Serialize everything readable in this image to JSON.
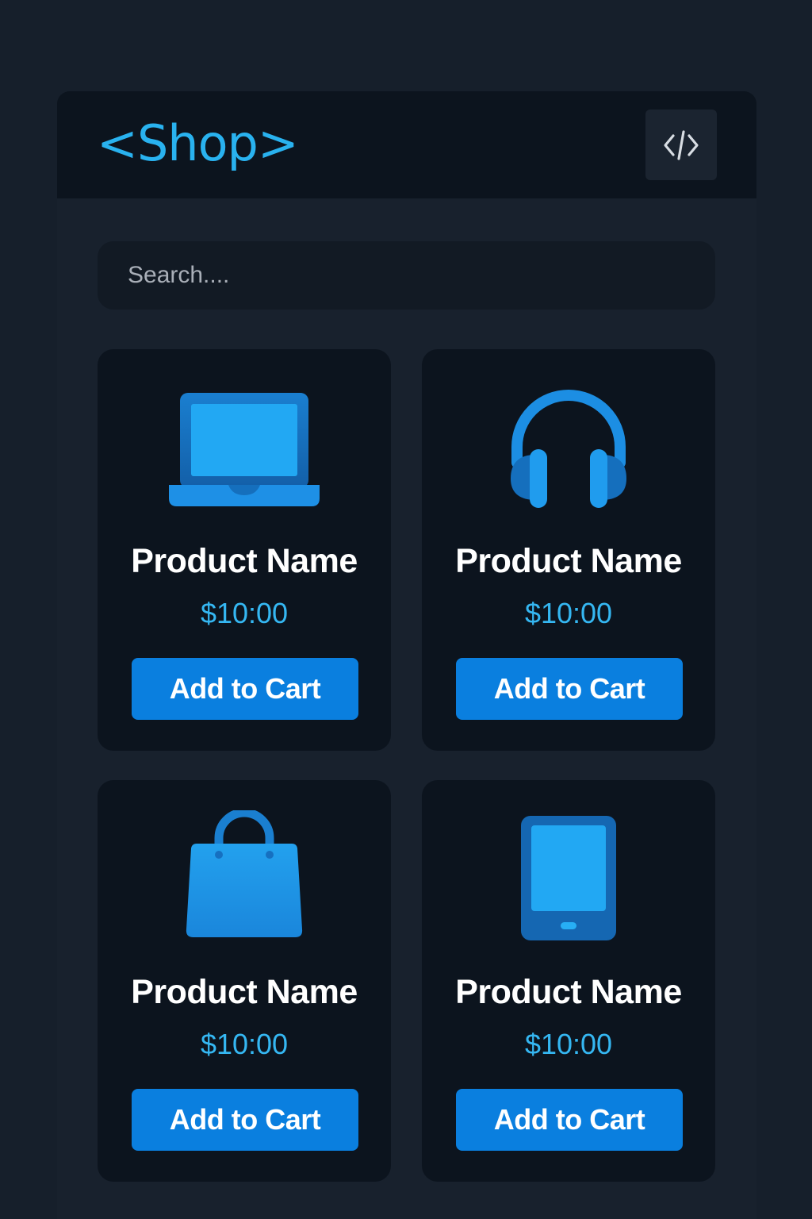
{
  "header": {
    "logo": "<Shop>",
    "code_button_icon": "code-icon"
  },
  "search": {
    "placeholder": "Search...."
  },
  "colors": {
    "accent": "#29b2ef",
    "button": "#0a7fdf",
    "background": "#161f2b",
    "card": "#0c141e"
  },
  "products": [
    {
      "icon": "laptop-icon",
      "name": "Product Name",
      "price": "$10:00",
      "button_label": "Add to Cart"
    },
    {
      "icon": "headphones-icon",
      "name": "Product Name",
      "price": "$10:00",
      "button_label": "Add to Cart"
    },
    {
      "icon": "shopping-bag-icon",
      "name": "Product Name",
      "price": "$10:00",
      "button_label": "Add to Cart"
    },
    {
      "icon": "tablet-icon",
      "name": "Product Name",
      "price": "$10:00",
      "button_label": "Add to Cart"
    }
  ]
}
